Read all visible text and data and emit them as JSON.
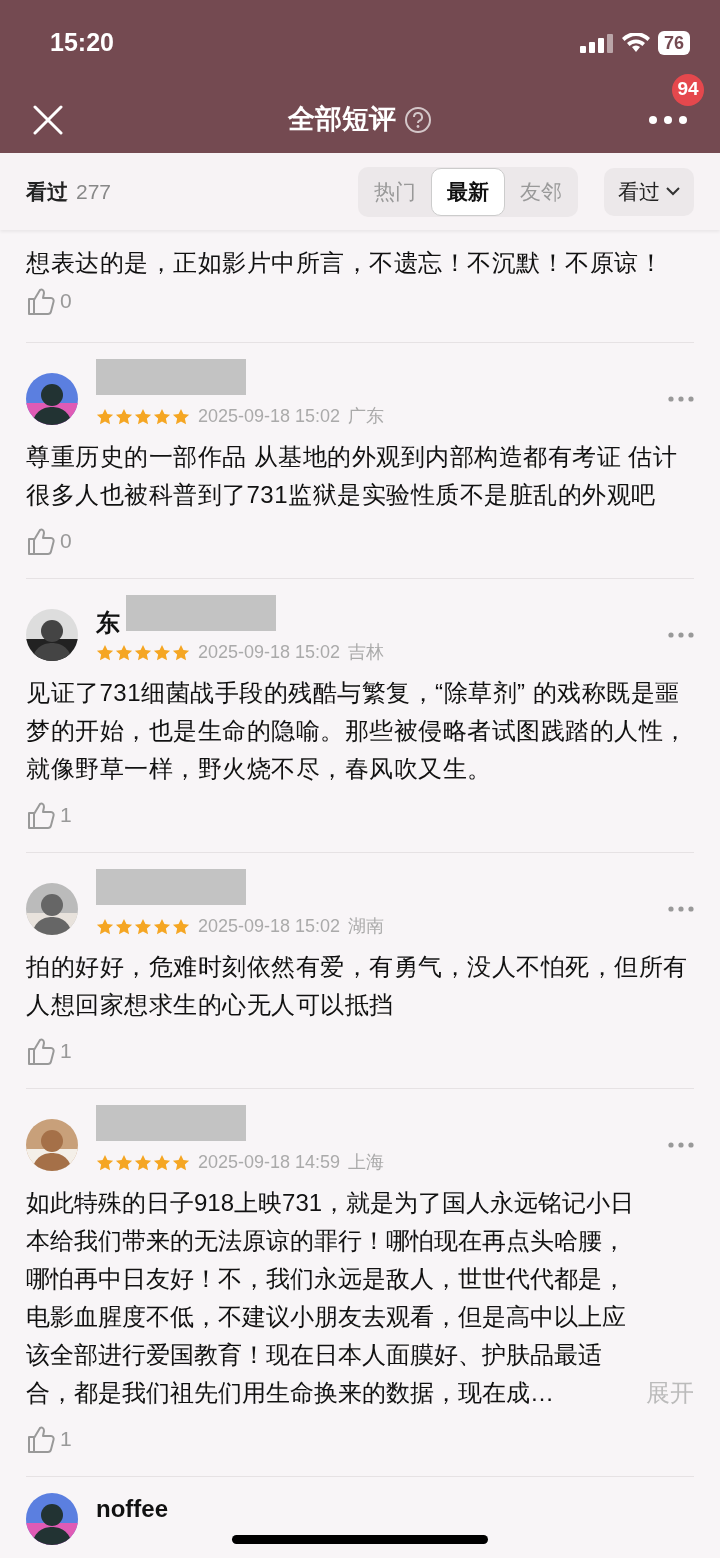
{
  "status_bar": {
    "time": "15:20",
    "battery": "76"
  },
  "header": {
    "title": "全部短评",
    "notification_badge": "94"
  },
  "filter_bar": {
    "label": "看过",
    "count": "277",
    "tabs": [
      {
        "label": "热门",
        "selected": false
      },
      {
        "label": "最新",
        "selected": true
      },
      {
        "label": "友邻",
        "selected": false
      }
    ],
    "dropdown": "看过"
  },
  "partial_review": {
    "text": "想表达的是，正如影片中所言，不遗忘！不沉默！不原谅！",
    "likes": "0"
  },
  "reviews": [
    {
      "stars": 5,
      "date": "2025-09-18 15:02",
      "location": "广东",
      "text": "尊重历史的一部作品 从基地的外观到内部构造都有考证 估计很多人也被科普到了731监狱是实验性质不是脏乱的外观吧",
      "likes": "0"
    },
    {
      "name": "东",
      "stars": 5,
      "date": "2025-09-18 15:02",
      "location": "吉林",
      "text": "见证了731细菌战手段的残酷与繁复，“除草剂” 的戏称既是噩梦的开始，也是生命的隐喻。那些被侵略者试图践踏的人性，就像野草一样，野火烧不尽，春风吹又生。",
      "likes": "1"
    },
    {
      "stars": 5,
      "date": "2025-09-18 15:02",
      "location": "湖南",
      "text": "拍的好好，危难时刻依然有爱，有勇气，没人不怕死，但所有人想回家想求生的心无人可以抵挡",
      "likes": "1"
    },
    {
      "stars": 5,
      "date": "2025-09-18 14:59",
      "location": "上海",
      "text": "如此特殊的日子918上映731，就是为了国人永远铭记小日本给我们带来的无法原谅的罪行！哪怕现在再点头哈腰，哪怕再中日友好！不，我们永远是敌人，世世代代都是，电影血腥度不低，不建议小朋友去观看，但是高中以上应该全部进行爱国教育！现在日本人面膜好、护肤品最适合，都是我们祖先们用生命换来的数据，现在成…",
      "expand": "展开",
      "likes": "1"
    }
  ],
  "last_review": {
    "name": "noffee"
  }
}
